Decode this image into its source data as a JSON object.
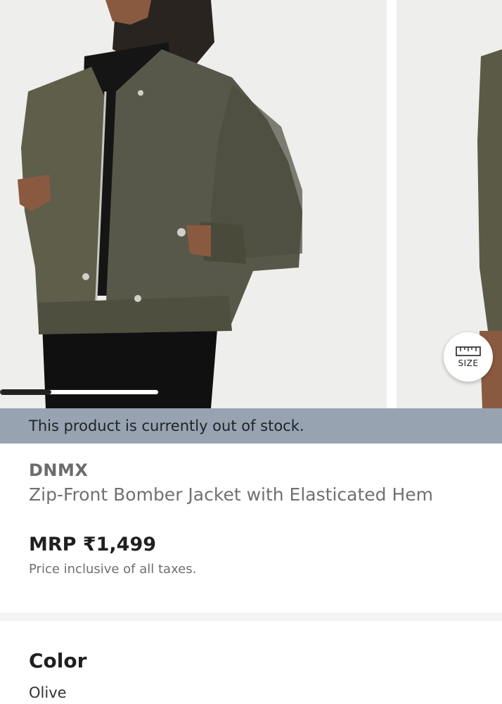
{
  "gallery": {
    "main_image_name": "product-photo-olive-bomber-jacket",
    "next_image_name": "product-photo-olive-bomber-jacket-alt",
    "progress_fraction": 0.32,
    "size_button": {
      "label": "SIZE",
      "icon": "ruler-icon"
    }
  },
  "stock_banner": {
    "text": "This product is currently out of stock."
  },
  "product": {
    "brand": "DNMX",
    "title": "Zip-Front Bomber Jacket with Elasticated Hem",
    "price": "MRP ₹1,499",
    "tax_note": "Price inclusive of all taxes."
  },
  "color_section": {
    "heading": "Color",
    "value": "Olive"
  },
  "colors": {
    "jacket": "#5a5a47",
    "banner": "#97a3b0",
    "accent_dark": "#1f1f1f"
  }
}
